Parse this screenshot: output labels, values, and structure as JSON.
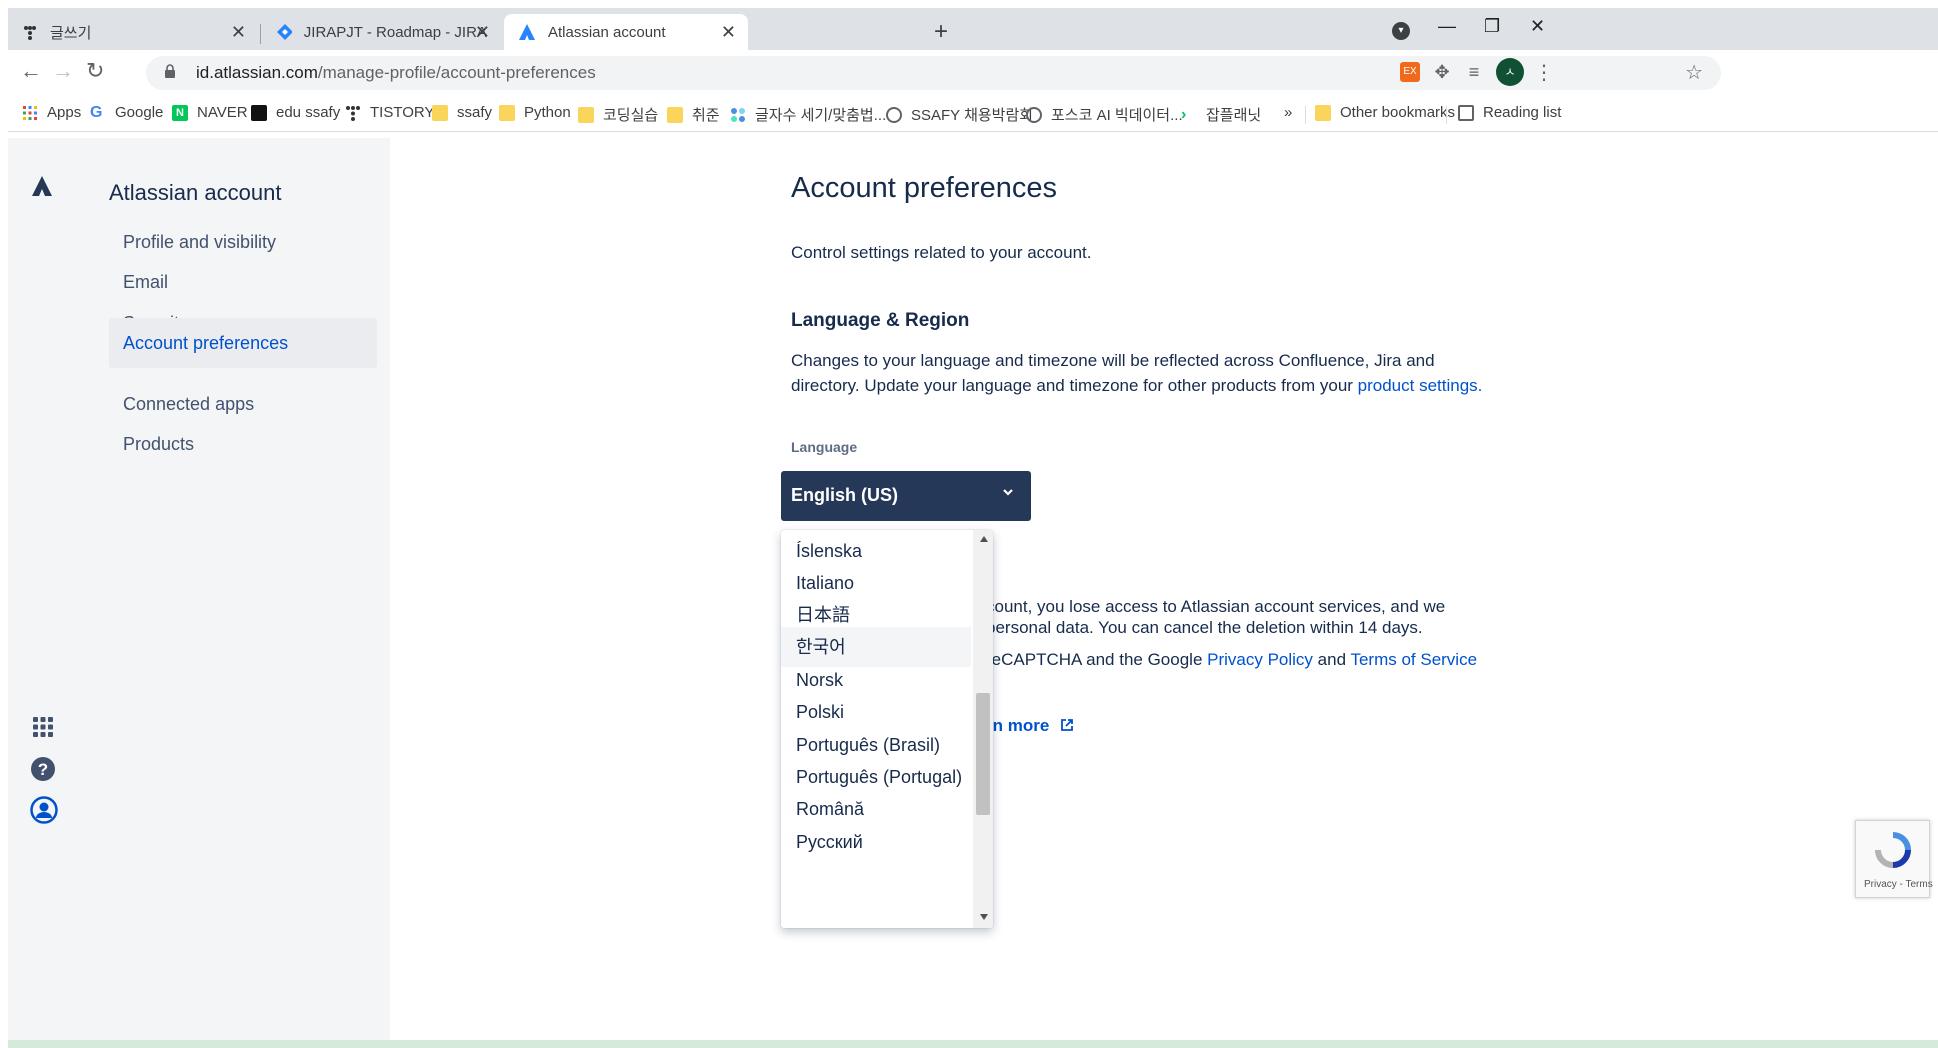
{
  "browser": {
    "tabs": [
      {
        "title": "글쓰기",
        "icon": "tistory-icon"
      },
      {
        "title": "JIRAPJT - Roadmap - JIRAPJT",
        "icon": "jira-icon"
      },
      {
        "title": "Atlassian account",
        "icon": "atlassian-icon",
        "active": true
      }
    ],
    "url_host": "id.atlassian.com",
    "url_path": "/manage-profile/account-preferences",
    "profile_initial": "ㅅ",
    "ext_label": "EX",
    "bookmarks": [
      {
        "label": "Apps",
        "icon": "apps-grid-icon"
      },
      {
        "label": "Google",
        "icon": "google-icon"
      },
      {
        "label": "NAVER",
        "icon": "naver-icon"
      },
      {
        "label": "edu ssafy",
        "icon": "edu-ssafy-icon"
      },
      {
        "label": "TISTORY",
        "icon": "tistory-icon"
      },
      {
        "label": "ssafy",
        "icon": "folder-icon"
      },
      {
        "label": "Python",
        "icon": "folder-icon"
      },
      {
        "label": "코딩실습",
        "icon": "folder-icon"
      },
      {
        "label": "취준",
        "icon": "folder-icon"
      },
      {
        "label": "글자수 세기/맞춤법...",
        "icon": "dots-icon"
      },
      {
        "label": "SSAFY 채용박람회",
        "icon": "globe-icon"
      },
      {
        "label": "포스코 AI 빅데이터...",
        "icon": "globe-icon"
      },
      {
        "label": "잡플래닛",
        "icon": "jobplanet-icon"
      }
    ],
    "more_bookmarks": "»",
    "other_bookmarks": "Other bookmarks",
    "reading_list": "Reading list"
  },
  "sidebar": {
    "brand": "Atlassian account",
    "items": [
      {
        "label": "Profile and visibility"
      },
      {
        "label": "Email"
      },
      {
        "label": "Security"
      },
      {
        "label": "Account preferences",
        "selected": true
      },
      {
        "label": "Connected apps"
      },
      {
        "label": "Products"
      }
    ]
  },
  "main": {
    "title": "Account preferences",
    "description": "Control settings related to your account.",
    "section_title": "Language & Region",
    "section_text_1": "Changes to your language and timezone will be reflected across Confluence, Jira and",
    "section_text_2": "directory. Update your language and timezone for other products from your ",
    "section_link": "product settings.",
    "language_label": "Language",
    "language_value": "English (US)",
    "language_options": [
      "Íslenska",
      "Italiano",
      "日本語",
      "한국어",
      "Norsk",
      "Polski",
      "Português (Brasil)",
      "Português (Portugal)",
      "Română",
      "Русский"
    ],
    "hovered_option": "한국어",
    "delete_text_1": "count, you lose access to Atlassian account services, and we",
    "delete_text_2": "personal data. You can cancel the deletion within 14 days.",
    "recaptcha_prefix": "reCAPTCHA and the Google ",
    "privacy_policy": "Privacy Policy",
    "and_text": " and ",
    "terms": "Terms of Service",
    "learn_more": "rn more"
  },
  "recaptcha_badge": "Privacy - Terms",
  "colors": {
    "sidebar_bg": "#f4f5f7",
    "selected_bg": "#ebecf0",
    "link": "#0052cc",
    "select_bg": "#253858",
    "text": "#172b4d"
  }
}
